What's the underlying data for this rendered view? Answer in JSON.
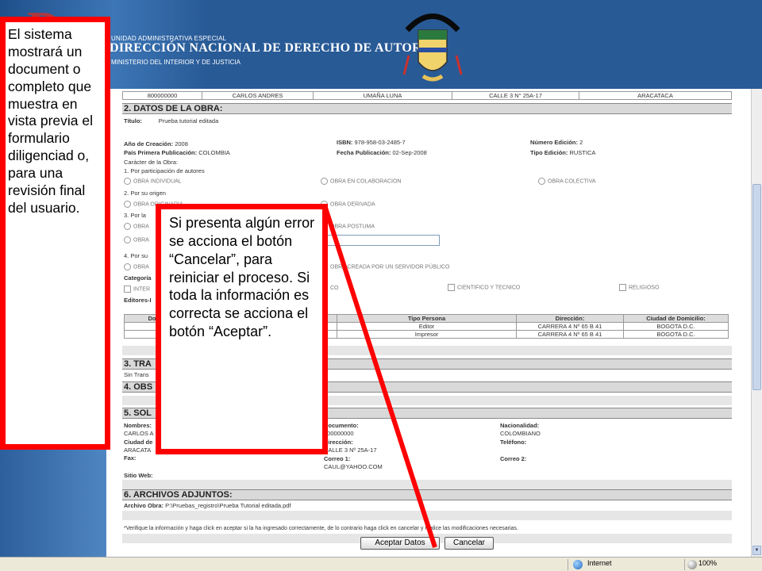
{
  "header": {
    "unit_text": "UNIDAD ADMINISTRATIVA ESPECIAL",
    "title": "DIRECCIÓN NACIONAL DE DERECHO DE AUTOR",
    "ministry_text": "MINISTERIO DEL INTERIOR Y DE JUSTICIA",
    "logo_icon": "colombia-coat-of-arms-icon"
  },
  "author_row": [
    "800000000",
    "CARLOS ANDRES",
    "UMAÑA LUNA",
    "CALLE 3 N° 25A-17",
    "ARACATACA"
  ],
  "section2": {
    "title": "2. DATOS DE LA OBRA:",
    "titulo_label": "Título:",
    "titulo_value": "Prueba tutorial editada",
    "anio_label": "Año de Creación:",
    "anio_value": "2008",
    "isbn_label": "ISBN:",
    "isbn_value": "978-958-03-2485-7",
    "edicion_label": "Número Edición:",
    "edicion_value": "2",
    "pais_label": "País Primera Publicación:",
    "pais_value": "COLOMBIA",
    "fecha_label": "Fecha Publicación:",
    "fecha_value": "02-Sep-2008",
    "tipo_ed_label": "Tipo Edición:",
    "tipo_ed_value": "RUSTICA",
    "caracter_label": "Carácter de la Obra:",
    "participacion_label": "1. Por participación de autores",
    "opt_individual": "OBRA INDIVIDUAL",
    "opt_colaboracion": "OBRA EN COLABORACION",
    "opt_colectiva": "OBRA COLECTIVA",
    "origen_label": "2. Por su origen",
    "opt_originaria": "OBRA ORIGINARIA",
    "opt_derivada": "OBRA DERIVADA",
    "por_la_label": "3. Por la",
    "opt_obra_a": "OBRA",
    "opt_obra_b": "OBRA",
    "opt_postuma": "OBRA POSTUMA",
    "por_su_label": "4. Por su",
    "opt_obra_c": "OBRA",
    "opt_servidor": "OBRA CREADA POR UN SERVIDOR PÚBLICO",
    "categoria_label": "Categoría",
    "cat_inter": "INTER",
    "cat_partial": "CO",
    "cat_cientifico": "CIENTIFICO Y TECNICO",
    "cat_religioso": "RELIGIOSO",
    "editores_label": "Editores-I",
    "editors_table": {
      "headers": [
        "Do",
        "",
        "Tipo Persona",
        "Dirección:",
        "Ciudad de Domicilio:"
      ],
      "rows": [
        [
          "",
          "",
          "Editor",
          "CARRERA 4 Nº 65 B 41",
          "BOGOTA D.C."
        ],
        [
          "",
          "",
          "Impresor",
          "CARRERA 4 Nº 65 B 41",
          "BOGOTA D.C."
        ]
      ]
    }
  },
  "section3": {
    "title": "3. TRA",
    "value": "Sin Trans"
  },
  "section4": {
    "title": "4. OBS"
  },
  "section5": {
    "title": "5. SOL",
    "nombres_label": "Nombres:",
    "nombres_value": "CARLOS A",
    "ciudad_label": "Ciudad de",
    "ciudad_value": "ARACATA",
    "fax_label": "Fax:",
    "sitio_label": "Sitio Web:",
    "documento_label": "Documento:",
    "documento_value": "800000000",
    "direccion_label": "Dirección:",
    "direccion_value": "CALLE 3 Nº 25A-17",
    "correo1_label": "Correo 1:",
    "correo1_value": "CAUL@YAHOO.COM",
    "nacionalidad_label": "Nacionalidad:",
    "nacionalidad_value": "COLOMBIANO",
    "telefono_label": "Teléfono:",
    "correo2_label": "Correo 2:"
  },
  "section6": {
    "title": "6. ARCHIVOS ADJUNTOS:",
    "archivo_label": "Archivo Obra:",
    "archivo_value": "P:\\Pruebas_registro\\Prueba Tutorial editada.pdf"
  },
  "notice": "*Verifique la información y haga click en aceptar si la ha ingresado correctamente, de lo contrario haga click en cancelar y realice las modificaciones necesarias.",
  "buttons": {
    "accept": "Aceptar Datos",
    "cancel": "Cancelar"
  },
  "statusbar": {
    "zone": "Internet",
    "zoom": "100%"
  },
  "callouts": {
    "left": "El sistema mostrará un document o completo que muestra en vista previa el formulario diligenciad o, para una revisión final del usuario.",
    "center": "Si presenta algún error se acciona el botón “Cancelar”, para reiniciar el proceso. Si toda la información es correcta se acciona el botón “Aceptar”."
  },
  "colors": {
    "callout_border": "#ff0000",
    "header_bg": "#285a96"
  }
}
